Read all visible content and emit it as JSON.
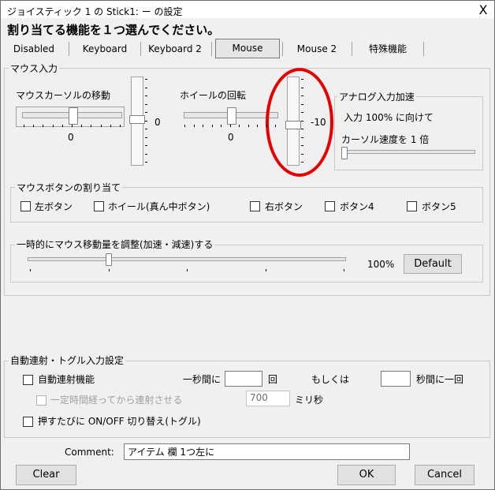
{
  "window": {
    "title": "ジョイスティック 1 の Stick1: ー の設定",
    "close_label": "X"
  },
  "heading": "割り当てる機能を１つ選んでください。",
  "tabs": [
    {
      "label": "Disabled"
    },
    {
      "label": "Keyboard"
    },
    {
      "label": "Keyboard 2"
    },
    {
      "label": "Mouse"
    },
    {
      "label": "Mouse 2"
    },
    {
      "label": "特殊機能"
    }
  ],
  "mouse_input": {
    "group_label": "マウス入力",
    "cursor_move_label": "マウスカーソルの移動",
    "cursor_h_value": "0",
    "cursor_v_value": "0",
    "wheel_label": "ホイールの回転",
    "wheel_h_value": "0",
    "wheel_v_value": "-10",
    "analog": {
      "group_label": "アナログ入力加速",
      "line1": "入力 100% に向けて",
      "line2": "カーソル速度を 1  倍"
    },
    "buttons": {
      "group_label": "マウスボタンの割り当て",
      "items": [
        "左ボタン",
        "ホイール(真ん中ボタン)",
        "右ボタン",
        "ボタン4",
        "ボタン5"
      ]
    },
    "temp_adjust": {
      "group_label": "一時的にマウス移動量を調整(加速・減速)する",
      "value": "100%",
      "default_label": "Default"
    }
  },
  "auto_fire": {
    "group_label": "自動連射・トグル入力設定",
    "auto_fire_label": "自動連射機能",
    "per_second_label": "一秒間に",
    "per_second_unit": "回",
    "or_label": "もしくは",
    "seconds_label": "秒間に一回",
    "delay_label": "一定時間経ってから連射させる",
    "delay_value": "700",
    "delay_unit": "ミリ秒",
    "toggle_label": "押すたびに ON/OFF 切り替え(トグル)"
  },
  "comment": {
    "label": "Comment:",
    "value": "アイテム 欄  1つ左に"
  },
  "footer": {
    "clear": "Clear",
    "ok": "OK",
    "cancel": "Cancel"
  },
  "colors": {
    "highlight_circle": "#e60000"
  }
}
